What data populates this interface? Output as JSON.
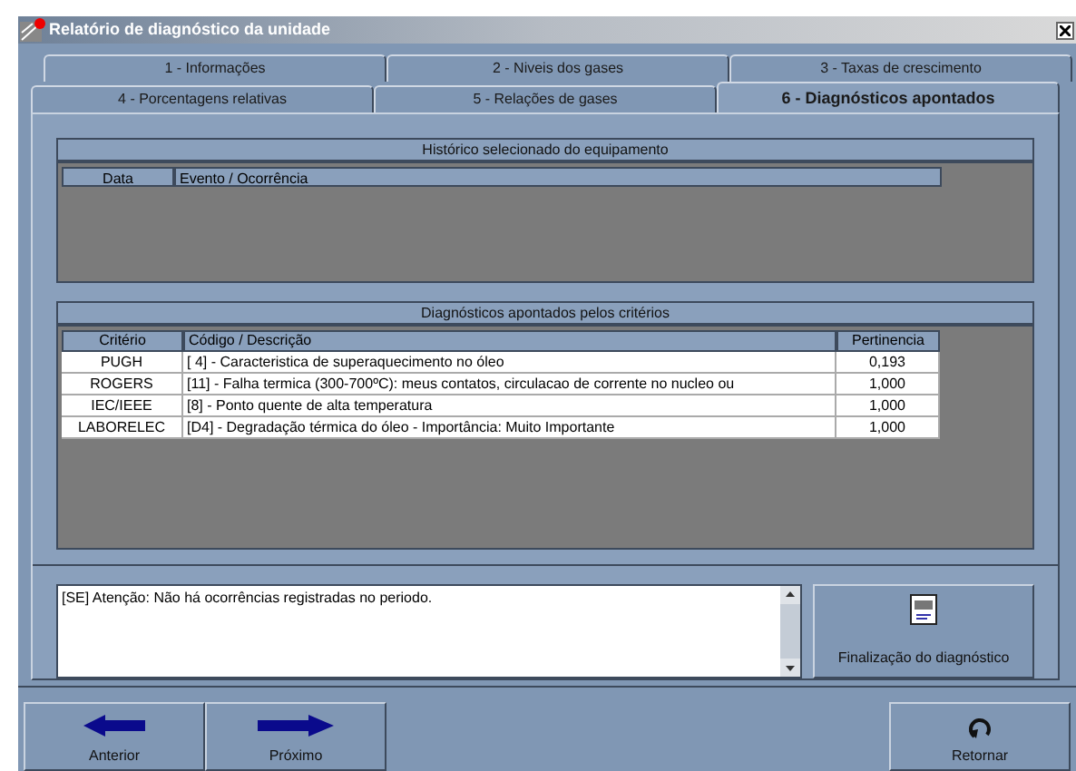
{
  "window": {
    "title": "Relatório de diagnóstico da unidade"
  },
  "tab_rows": [
    [
      {
        "label": "1 - Informações",
        "selected": false
      },
      {
        "label": "2 - Niveis dos gases",
        "selected": false
      },
      {
        "label": "3 - Taxas de crescimento",
        "selected": false
      }
    ],
    [
      {
        "label": "4 - Porcentagens relativas",
        "selected": false
      },
      {
        "label": "5 - Relações de gases",
        "selected": false
      },
      {
        "label": "6 - Diagnósticos apontados",
        "selected": true
      }
    ]
  ],
  "history": {
    "title": "Histórico selecionado do equipamento",
    "columns": [
      "Data",
      "Evento / Ocorrência"
    ]
  },
  "diagnostics": {
    "title": "Diagnósticos apontados pelos critérios",
    "columns": [
      "Critério",
      "Código / Descrição",
      "Pertinencia"
    ],
    "rows": [
      [
        "PUGH",
        "[ 4] - Caracteristica de superaquecimento no óleo",
        "0,193"
      ],
      [
        "ROGERS",
        "[11] - Falha termica (300-700ºC): meus contatos, circulacao de corrente no nucleo ou",
        "1,000"
      ],
      [
        "IEC/IEEE",
        "[8] - Ponto quente de alta temperatura",
        "1,000"
      ],
      [
        "LABORELEC",
        "[D4] - Degradação térmica do óleo - Importância: Muito Importante",
        "1,000"
      ]
    ]
  },
  "message": "[SE] Atenção: Não há ocorrências registradas no periodo.",
  "finalize_button": "Finalização do diagnóstico",
  "nav_buttons": [
    {
      "label": "Anterior",
      "kind": "back"
    },
    {
      "label": "Próximo",
      "kind": "next"
    },
    {
      "label": "Retornar",
      "kind": "return"
    }
  ]
}
